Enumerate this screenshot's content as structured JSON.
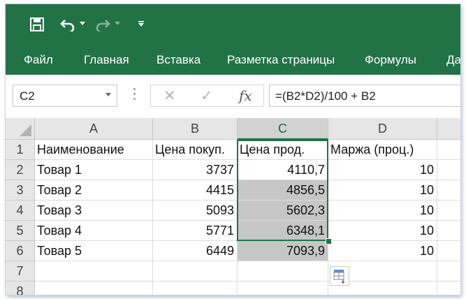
{
  "quick_access": {
    "save_icon": "save-icon",
    "undo_icon": "undo-icon",
    "redo_icon": "redo-icon",
    "customize_icon": "customize-toolbar-icon"
  },
  "ribbon_tabs": [
    "Файл",
    "Главная",
    "Вставка",
    "Разметка страницы",
    "Формулы",
    "Да"
  ],
  "formula_bar": {
    "name_box": "C2",
    "cancel_glyph": "✕",
    "enter_glyph": "✓",
    "fx_label": "fx",
    "formula": "=(B2*D2)/100 + B2"
  },
  "columns": [
    "A",
    "B",
    "C",
    "D"
  ],
  "rows": [
    "1",
    "2",
    "3",
    "4",
    "5",
    "6",
    "7",
    "8"
  ],
  "table": {
    "header": [
      "Наименование",
      "Цена покуп.",
      "Цена прод.",
      "Маржа (проц.)"
    ],
    "data": [
      [
        "Товар 1",
        "3737",
        "4110,7",
        "10"
      ],
      [
        "Товар 2",
        "4415",
        "4856,5",
        "10"
      ],
      [
        "Товар 3",
        "5093",
        "5602,3",
        "10"
      ],
      [
        "Товар 4",
        "5771",
        "6348,1",
        "10"
      ],
      [
        "Товар 5",
        "6449",
        "7093,9",
        "10"
      ]
    ]
  },
  "selection": {
    "active_cell": "C2",
    "range": "C2:C6"
  },
  "colors": {
    "ribbon": "#217346",
    "selection": "#217346",
    "header_bg": "#e6e6e6",
    "shaded": "#c6c6c6"
  }
}
